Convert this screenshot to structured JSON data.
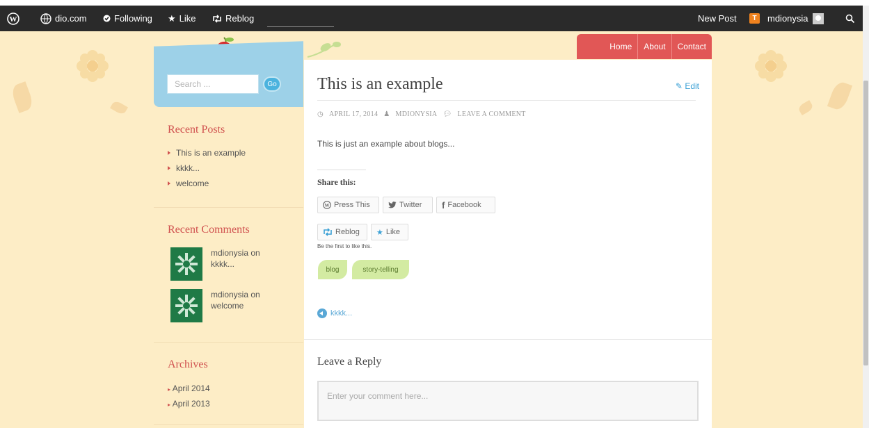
{
  "adminbar": {
    "site": "dio.com",
    "following": "Following",
    "like": "Like",
    "reblog": "Reblog",
    "new_post": "New Post",
    "user": "mdionysia"
  },
  "search": {
    "placeholder": "Search ...",
    "go": "Go"
  },
  "nav": {
    "home": "Home",
    "about": "About",
    "contact": "Contact"
  },
  "sidebar": {
    "recent_posts_title": "Recent Posts",
    "recent_posts": [
      "This is an example",
      "kkkk...",
      "welcome"
    ],
    "recent_comments_title": "Recent Comments",
    "comments": [
      {
        "author": "mdionysia",
        "on": "on",
        "post": "kkkk..."
      },
      {
        "author": "mdionysia",
        "on": "on",
        "post": "welcome"
      }
    ],
    "archives_title": "Archives",
    "archives": [
      "April 2014",
      "April 2013"
    ]
  },
  "post": {
    "title": "This is an example",
    "edit": "Edit",
    "date": "APRIL 17, 2014",
    "author": "MDIONYSIA",
    "comment_link": "LEAVE A COMMENT",
    "body": "This is just an example about blogs...",
    "share_title": "Share this:",
    "share": {
      "press_this": "Press This",
      "twitter": "Twitter",
      "facebook": "Facebook"
    },
    "reblog": "Reblog",
    "like": "Like",
    "first_like": "Be the first to like this.",
    "tags": [
      "blog",
      "story-telling"
    ],
    "prev_post": "kkkk..."
  },
  "reply": {
    "title": "Leave a Reply",
    "placeholder": "Enter your comment here..."
  },
  "colors": {
    "accent_red": "#e15756",
    "link_blue": "#3aa0d5",
    "bg": "#fdedc6"
  }
}
